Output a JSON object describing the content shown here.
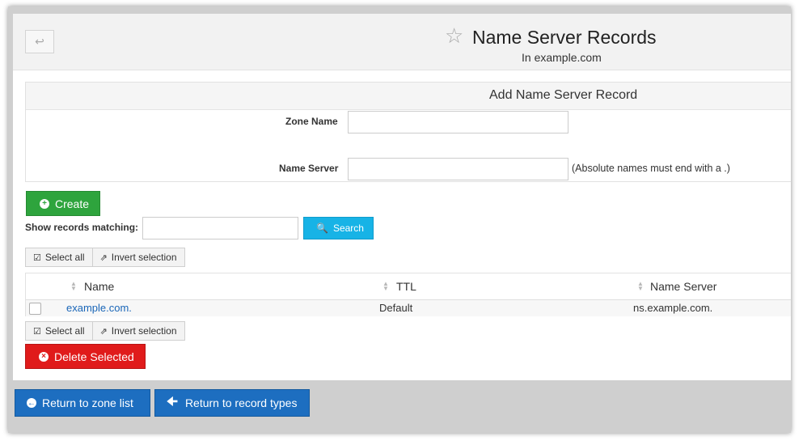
{
  "header": {
    "back_icon": "return-arrow-icon",
    "star_icon": "star-outline-icon",
    "title": "Name Server Records",
    "subtitle": "In example.com"
  },
  "form": {
    "title": "Add Name Server Record",
    "zone_name_label": "Zone Name",
    "zone_name_value": "",
    "name_server_label": "Name Server",
    "name_server_value": "",
    "name_server_hint": "(Absolute names must end with a .)"
  },
  "create_button": "Create",
  "search": {
    "label": "Show records matching:",
    "value": "",
    "button": "Search"
  },
  "selection": {
    "select_all": "Select all",
    "invert": "Invert selection"
  },
  "table": {
    "columns": [
      "Name",
      "TTL",
      "Name Server"
    ],
    "rows": [
      {
        "name": "example.com.",
        "ttl": "Default",
        "name_server": "ns.example.com."
      }
    ]
  },
  "delete_button": "Delete Selected",
  "footer": {
    "zone_list": "Return to zone list",
    "record_types": "Return to record types"
  },
  "colors": {
    "create": "#2ea43d",
    "delete": "#e01b1b",
    "search": "#17b3e6",
    "nav": "#1d6ec0",
    "link": "#1a66b8"
  }
}
